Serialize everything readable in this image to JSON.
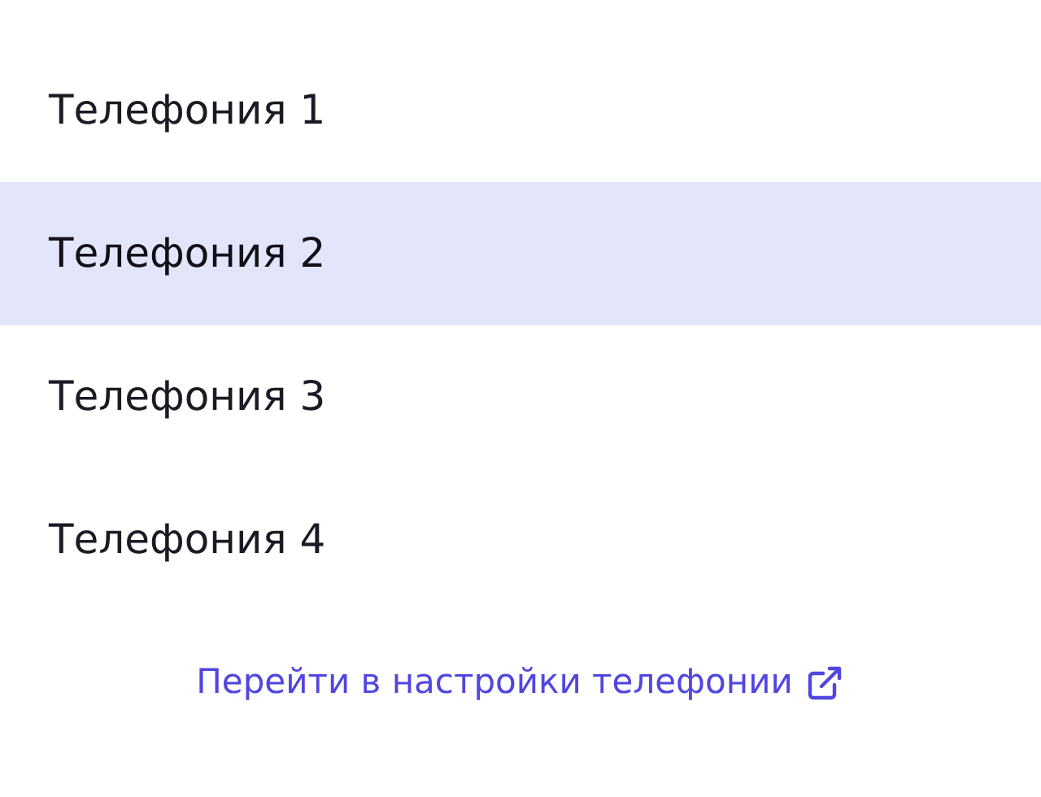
{
  "items": [
    {
      "label": "Телефония 1",
      "selected": false
    },
    {
      "label": "Телефония 2",
      "selected": true
    },
    {
      "label": "Телефония 3",
      "selected": false
    },
    {
      "label": "Телефония 4",
      "selected": false
    }
  ],
  "link": {
    "label": "Перейти в настройки телефонии"
  }
}
